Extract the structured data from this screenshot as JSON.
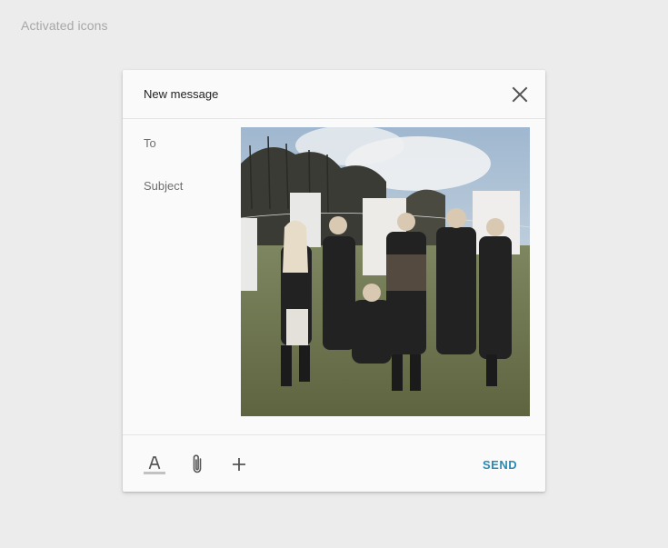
{
  "page": {
    "caption": "Activated icons"
  },
  "dialog": {
    "title": "New message",
    "close_icon": "close-icon",
    "fields": {
      "to_label": "To",
      "subject_label": "Subject"
    },
    "attachment": {
      "kind": "photo",
      "description_icon": "photo-thumbnail"
    },
    "footer": {
      "icons": [
        "text-format-icon",
        "attachment-icon",
        "plus-icon"
      ],
      "send_label": "SEND"
    }
  },
  "colors": {
    "background": "#ececec",
    "dialog": "#fafafa",
    "accent": "#2a8bb5",
    "caption": "#a7a7a7",
    "divider": "#e4e4e4"
  }
}
